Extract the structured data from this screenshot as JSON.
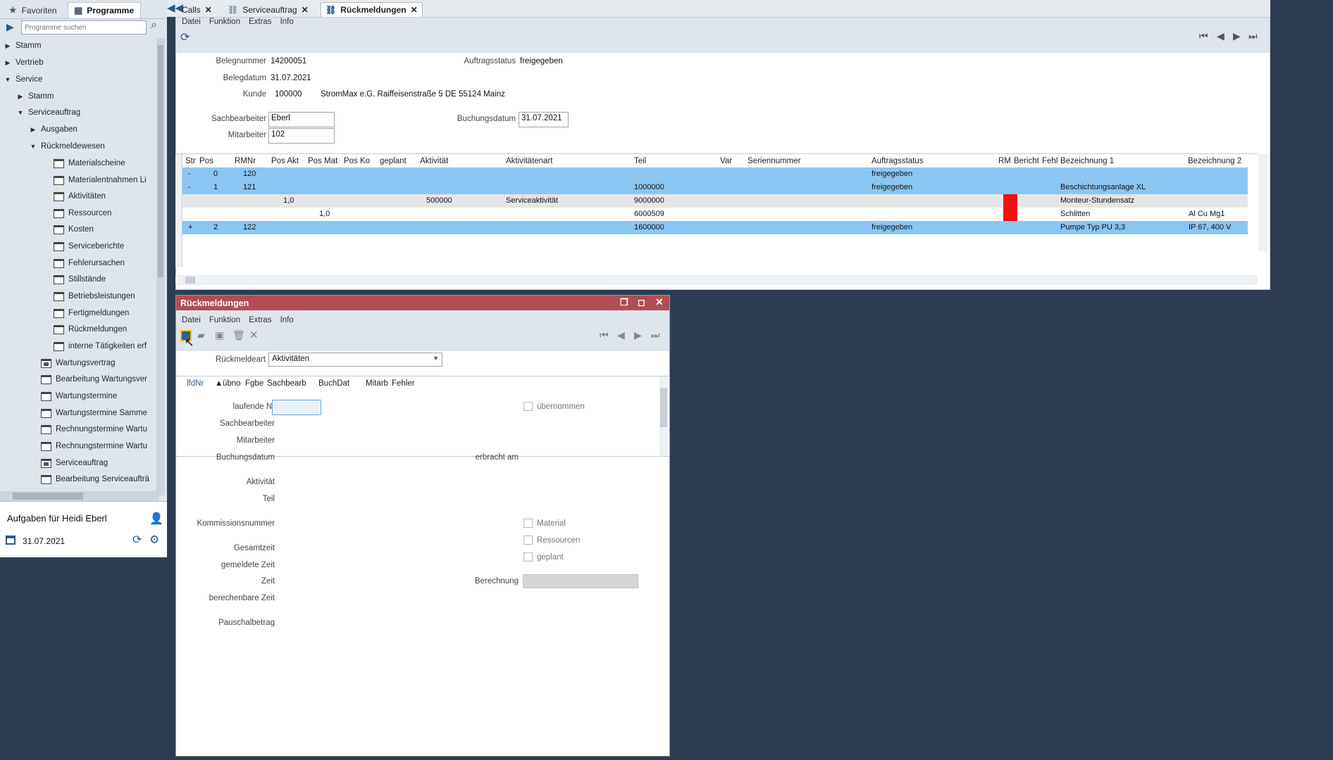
{
  "sidebar": {
    "tabs": {
      "favorites": "Favoriten",
      "programs": "Programme"
    },
    "search_placeholder": "Programme suchen",
    "tree": [
      {
        "label": "Stamm",
        "arrow": "▶"
      },
      {
        "label": "Vertrieb",
        "arrow": "▶"
      },
      {
        "label": "Service",
        "arrow": "▼"
      },
      {
        "label": "Stamm",
        "arrow": "▶"
      },
      {
        "label": "Serviceauftrag",
        "arrow": "▼"
      },
      {
        "label": "Ausgaben",
        "arrow": "▶"
      },
      {
        "label": "Rückmeldewesen",
        "arrow": "▼"
      },
      {
        "label": "Materialscheine"
      },
      {
        "label": "Materialentnahmen Li"
      },
      {
        "label": "Aktivitäten"
      },
      {
        "label": "Ressourcen"
      },
      {
        "label": "Kosten"
      },
      {
        "label": "Serviceberichte"
      },
      {
        "label": "Fehlerursachen"
      },
      {
        "label": "Stillstände"
      },
      {
        "label": "Betriebsleistungen"
      },
      {
        "label": "Fertigmeldungen"
      },
      {
        "label": "Rückmeldungen"
      },
      {
        "label": "interne Tätigkeiten erf"
      },
      {
        "label": "Wartungsvertrag"
      },
      {
        "label": "Bearbeitung Wartungsver"
      },
      {
        "label": "Wartungstermine"
      },
      {
        "label": "Wartungstermine Samme"
      },
      {
        "label": "Rechnungstermine Wartu"
      },
      {
        "label": "Rechnungstermine Wartu"
      },
      {
        "label": "Serviceauftrag"
      },
      {
        "label": "Bearbeitung Serviceaufträ"
      }
    ],
    "tasks_title": "Aufgaben für Heidi Eberl",
    "tasks_date": "31.07.2021"
  },
  "tabs": [
    {
      "label": "Calls"
    },
    {
      "label": "Serviceauftrag"
    },
    {
      "label": "Rückmeldungen"
    }
  ],
  "menu": {
    "file": "Datei",
    "function": "Funktion",
    "extras": "Extras",
    "info": "Info"
  },
  "header": {
    "belegnummer_label": "Belegnummer",
    "belegnummer": "14200051",
    "belegdatum_label": "Belegdatum",
    "belegdatum": "31.07.2021",
    "kunde_label": "Kunde",
    "kunde_nr": "100000",
    "kunde_name": "StromMax e.G. Raiffeisenstraße 5 DE 55124 Mainz",
    "auftragsstatus_label": "Auftragsstatus",
    "auftragsstatus": "freigegeben",
    "sachbearbeiter_label": "Sachbearbeiter",
    "sachbearbeiter": "Eberl",
    "mitarbeiter_label": "Mitarbeiter",
    "mitarbeiter": "102",
    "buchungsdatum_label": "Buchungsdatum",
    "buchungsdatum": "31.07.2021"
  },
  "grid": {
    "columns": [
      "Str",
      "Pos",
      "RMNr",
      "Pos Akt",
      "Pos Mat",
      "Pos Ko",
      "geplant",
      "Aktivität",
      "Aktivitätenart",
      "Teil",
      "Var",
      "Seriennummer",
      "Auftragsstatus",
      "RM",
      "Bericht",
      "Fehl",
      "Bezeichnung 1",
      "Bezeichnung 2"
    ],
    "rows": [
      {
        "str": "-",
        "pos": "0",
        "rmnr": "120",
        "posakt": "",
        "posmat": "",
        "akt": "",
        "aktart": "",
        "teil": "",
        "status": "freigegeben",
        "bez1": "",
        "bez2": ""
      },
      {
        "str": "-",
        "pos": "1",
        "rmnr": "121",
        "posakt": "",
        "posmat": "",
        "akt": "",
        "aktart": "",
        "teil": "1000000",
        "status": "freigegeben",
        "bez1": "Beschichtungsanlage XL",
        "bez2": ""
      },
      {
        "str": "",
        "pos": "",
        "rmnr": "",
        "posakt": "1,0",
        "posmat": "",
        "akt": "500000",
        "aktart": "Serviceaktivität",
        "teil": "9000000",
        "status": "",
        "bez1": "Monteur-Stundensatz",
        "bez2": ""
      },
      {
        "str": "",
        "pos": "",
        "rmnr": "",
        "posakt": "",
        "posmat": "1,0",
        "akt": "",
        "aktart": "",
        "teil": "6000509",
        "status": "",
        "bez1": "Schlitten",
        "bez2": "Al Cu Mg1"
      },
      {
        "str": "+",
        "pos": "2",
        "rmnr": "122",
        "posakt": "",
        "posmat": "",
        "akt": "",
        "aktart": "",
        "teil": "1600000",
        "status": "freigegeben",
        "bez1": "Pumpe Typ PU 3,3",
        "bez2": "IP 67, 400 V"
      }
    ]
  },
  "sub": {
    "title": "Rückmeldungen",
    "rueckmeldeart_label": "Rückmeldeart",
    "rueckmeldeart": "Aktivitäten",
    "columns": [
      "lfdNr",
      "übno",
      "Fgbe",
      "Sachbearb",
      "BuchDat",
      "Mitarb",
      "Fehler"
    ],
    "fields": {
      "laufende": "laufende Nr",
      "sachbearbeiter": "Sachbearbeiter",
      "mitarbeiter": "Mitarbeiter",
      "buchungsdatum": "Buchungsdatum",
      "erbracht": "erbracht am",
      "aktivitaet": "Aktivität",
      "teil": "Teil",
      "kommission": "Kommissionsnummer",
      "gesamtzeit": "Gesamtzeit",
      "gemeldete": "gemeldete Zeit",
      "zeit": "Zeit",
      "berechnung": "Berechnung",
      "berechenbare": "berechenbare Zeit",
      "pauschal": "Pauschalbetrag"
    },
    "checks": {
      "uebernommen": "übernommen",
      "material": "Material",
      "ressourcen": "Ressourcen",
      "geplant": "geplant"
    }
  },
  "colors": {
    "selected_row": "#8ac6f2",
    "title_bar": "#b14c54",
    "flag": "#f01010"
  }
}
